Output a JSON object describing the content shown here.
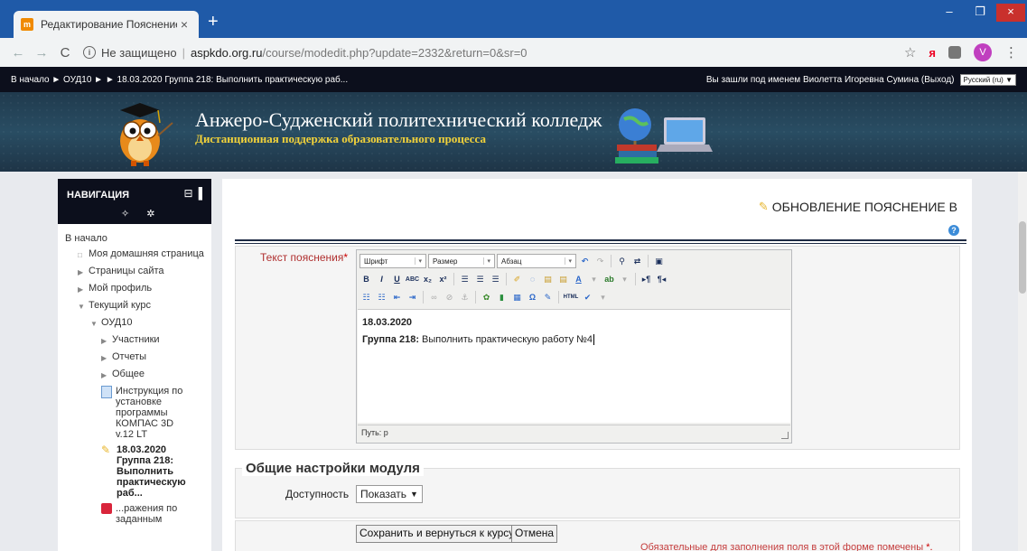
{
  "browser": {
    "tab_title": "Редактирование Пояснение",
    "tab_favicon": "m",
    "tab_close": "×",
    "new_tab": "+",
    "not_secure": "Не защищено",
    "url_host": "aspkdo.org.ru",
    "url_path": "/course/modedit.php?update=2332&return=0&sr=0",
    "avatar_letter": "V",
    "back": "←",
    "forward": "→",
    "reload": "C",
    "star": "☆",
    "ya": "я",
    "menu": "⋮",
    "minimize": "–",
    "maximize": "❐",
    "close": "×"
  },
  "topstrip": {
    "breadcrumb": "В начало ► ОУД10 ► ► 18.03.2020 Группа 218: Выполнить практическую раб...",
    "login_text": "Вы зашли под именем Виолетта Игоревна Сумина (Выход)",
    "language": "Русский (ru) ▼"
  },
  "banner": {
    "title": "Анжеро-Судженский политехнический колледж",
    "subtitle": "Дистанционная поддержка образовательного процесса"
  },
  "navigation": {
    "title": "НАВИГАЦИЯ",
    "head_icons": "⊟▐",
    "tool_icons": "✧ ✲",
    "items": [
      {
        "label": "В начало"
      },
      {
        "label": "Моя домашняя страница"
      },
      {
        "label": "Страницы сайта"
      },
      {
        "label": "Мой профиль"
      },
      {
        "label": "Текущий курс"
      },
      {
        "label": "ОУД10"
      },
      {
        "label": "Участники"
      },
      {
        "label": "Отчеты"
      },
      {
        "label": "Общее"
      },
      {
        "label": "Инструкция по установке программы КОМПАС 3D v.12 LT"
      },
      {
        "label": "18.03.2020 Группа 218: Выполнить практическую раб..."
      },
      {
        "label": "...ражения по заданным"
      }
    ]
  },
  "main": {
    "heading": "ОБНОВЛЕНИЕ ПОЯСНЕНИЕ В",
    "help": "?",
    "field_label": "Текст пояснения",
    "required_mark": "*",
    "editor": {
      "font_select": "Шрифт",
      "size_select": "Размер",
      "format_select": "Абзац",
      "content_date": "18.03.2020",
      "content_group": "Группа 218:",
      "content_task": " Выполнить практическую работу №4",
      "path_label": "Путь: p"
    },
    "module_settings_legend": "Общие настройки модуля",
    "availability_label": "Доступность",
    "availability_value": "Показать",
    "save_button": "Сохранить и вернуться к курсу",
    "cancel_button": "Отмена",
    "required_note": "Обязательные для заполнения поля в этой форме помечены",
    "required_note_mark": "*."
  }
}
